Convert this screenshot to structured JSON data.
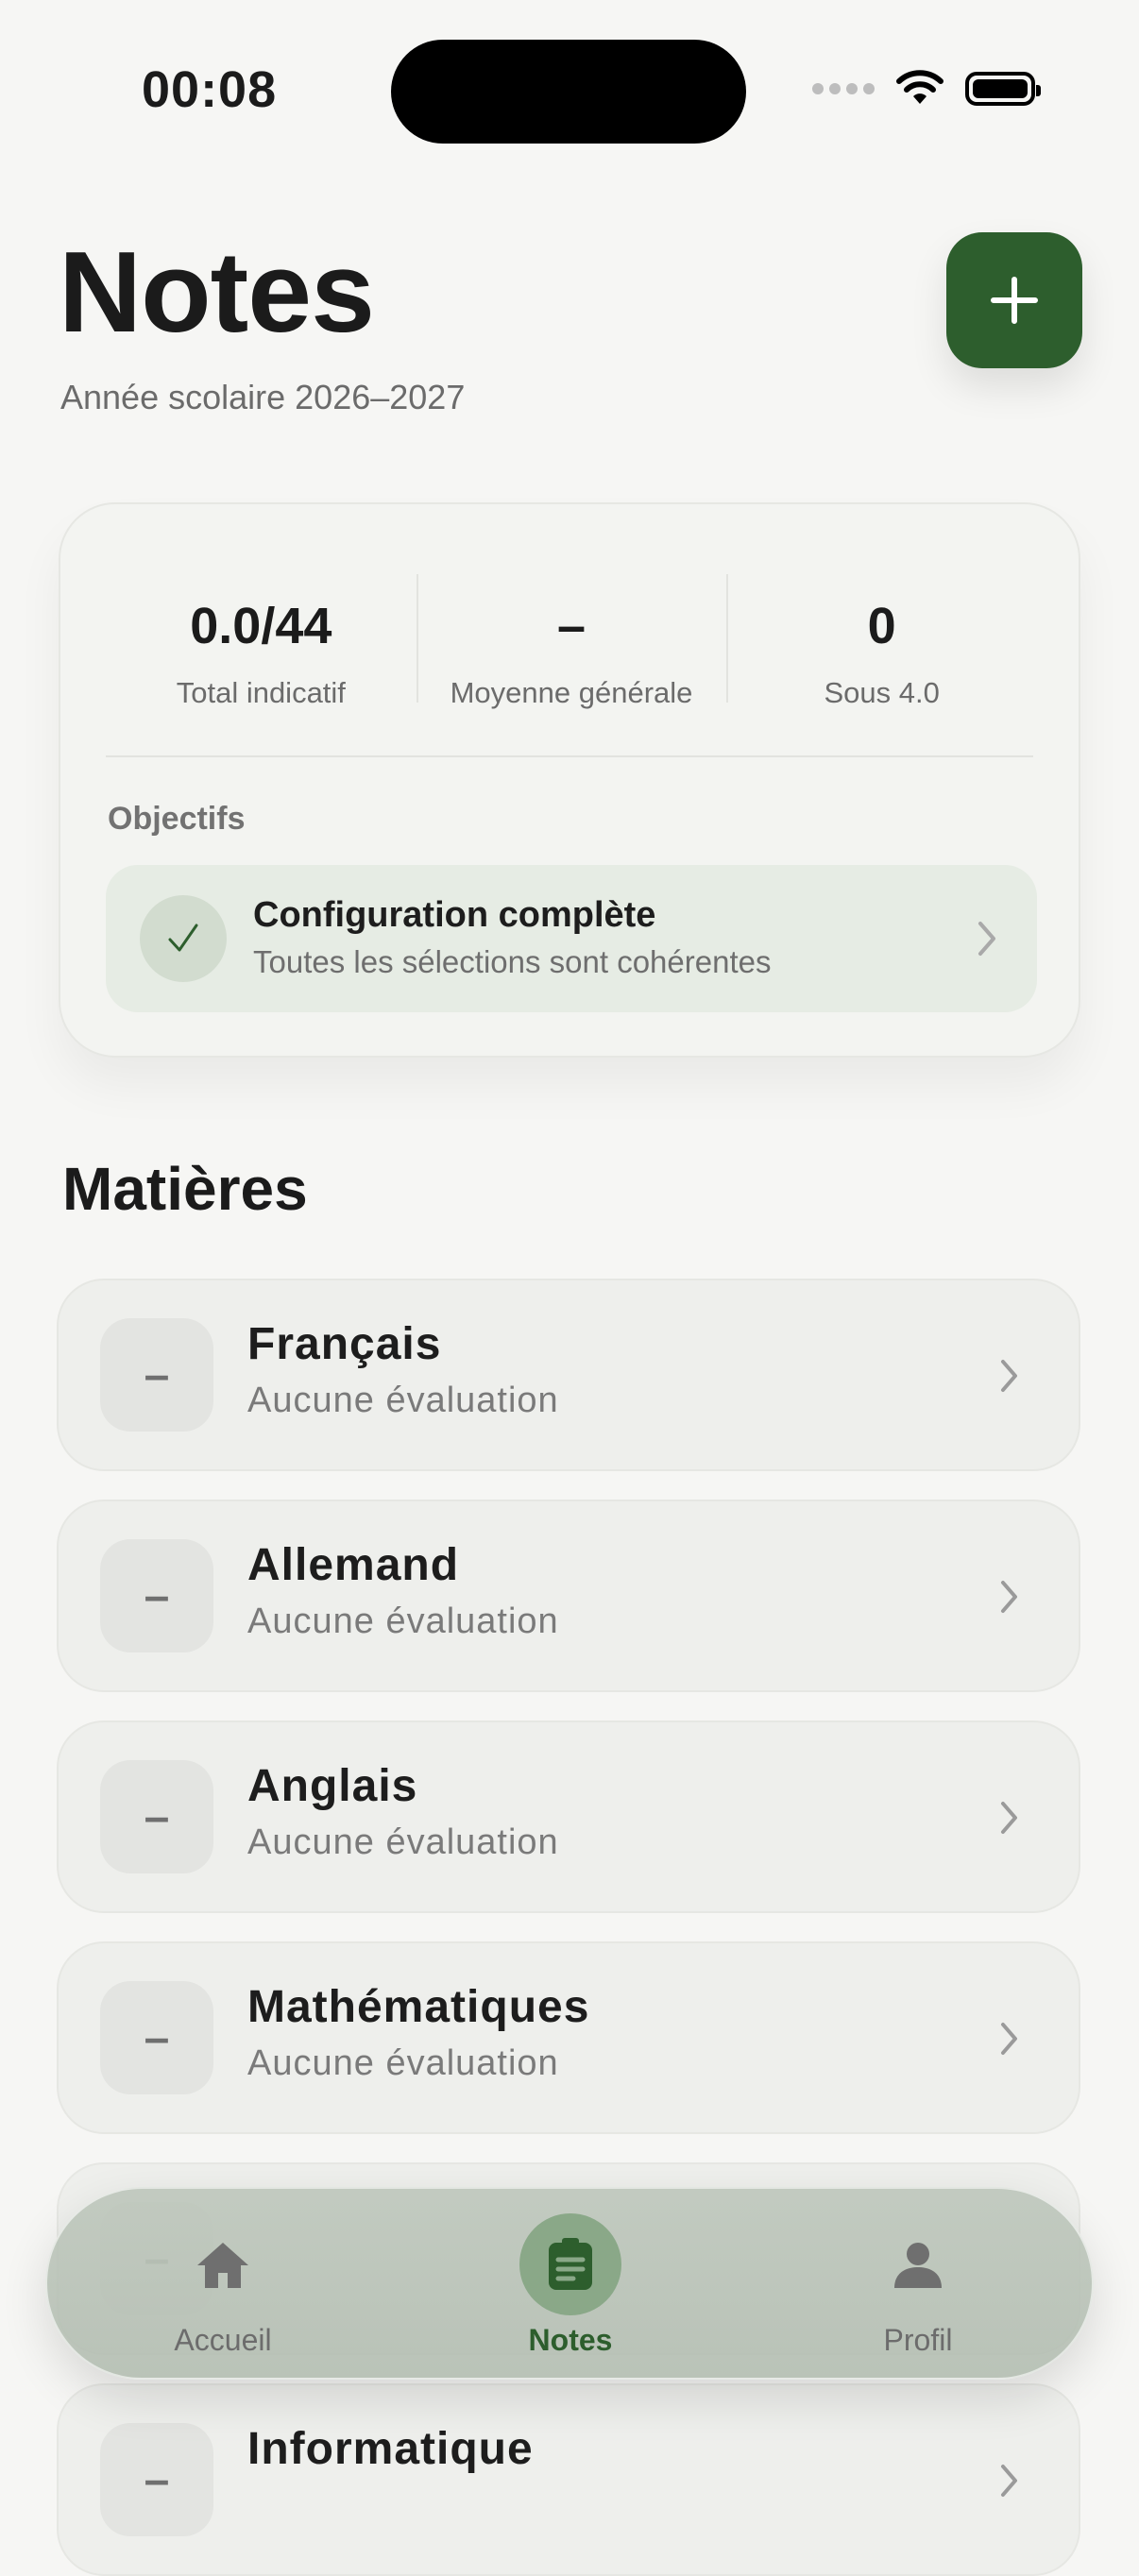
{
  "status_bar": {
    "time": "00:08"
  },
  "header": {
    "title": "Notes",
    "subtitle": "Année scolaire 2026–2027",
    "add_icon": "plus-icon"
  },
  "summary": {
    "stats": [
      {
        "value": "0.0/44",
        "label": "Total indicatif"
      },
      {
        "value": "–",
        "label": "Moyenne générale"
      },
      {
        "value": "0",
        "label": "Sous 4.0"
      }
    ],
    "goals_label": "Objectifs",
    "goal": {
      "title": "Configuration complète",
      "subtitle": "Toutes les sélections sont cohérentes",
      "icon": "check-icon"
    }
  },
  "section": {
    "title": "Matières"
  },
  "subjects": [
    {
      "badge": "–",
      "name": "Français",
      "status": "Aucune évaluation"
    },
    {
      "badge": "–",
      "name": "Allemand",
      "status": "Aucune évaluation"
    },
    {
      "badge": "–",
      "name": "Anglais",
      "status": "Aucune évaluation"
    },
    {
      "badge": "–",
      "name": "Mathématiques",
      "status": "Aucune évaluation"
    },
    {
      "badge": "–",
      "name": "",
      "status": ""
    },
    {
      "badge": "–",
      "name": "Informatique",
      "status": ""
    }
  ],
  "tab_bar": {
    "tabs": [
      {
        "label": "Accueil",
        "icon": "home-icon"
      },
      {
        "label": "Notes",
        "icon": "clipboard-icon",
        "active": true
      },
      {
        "label": "Profil",
        "icon": "person-icon"
      }
    ]
  },
  "colors": {
    "accent": "#2d5e2d",
    "background": "#f6f6f4"
  }
}
